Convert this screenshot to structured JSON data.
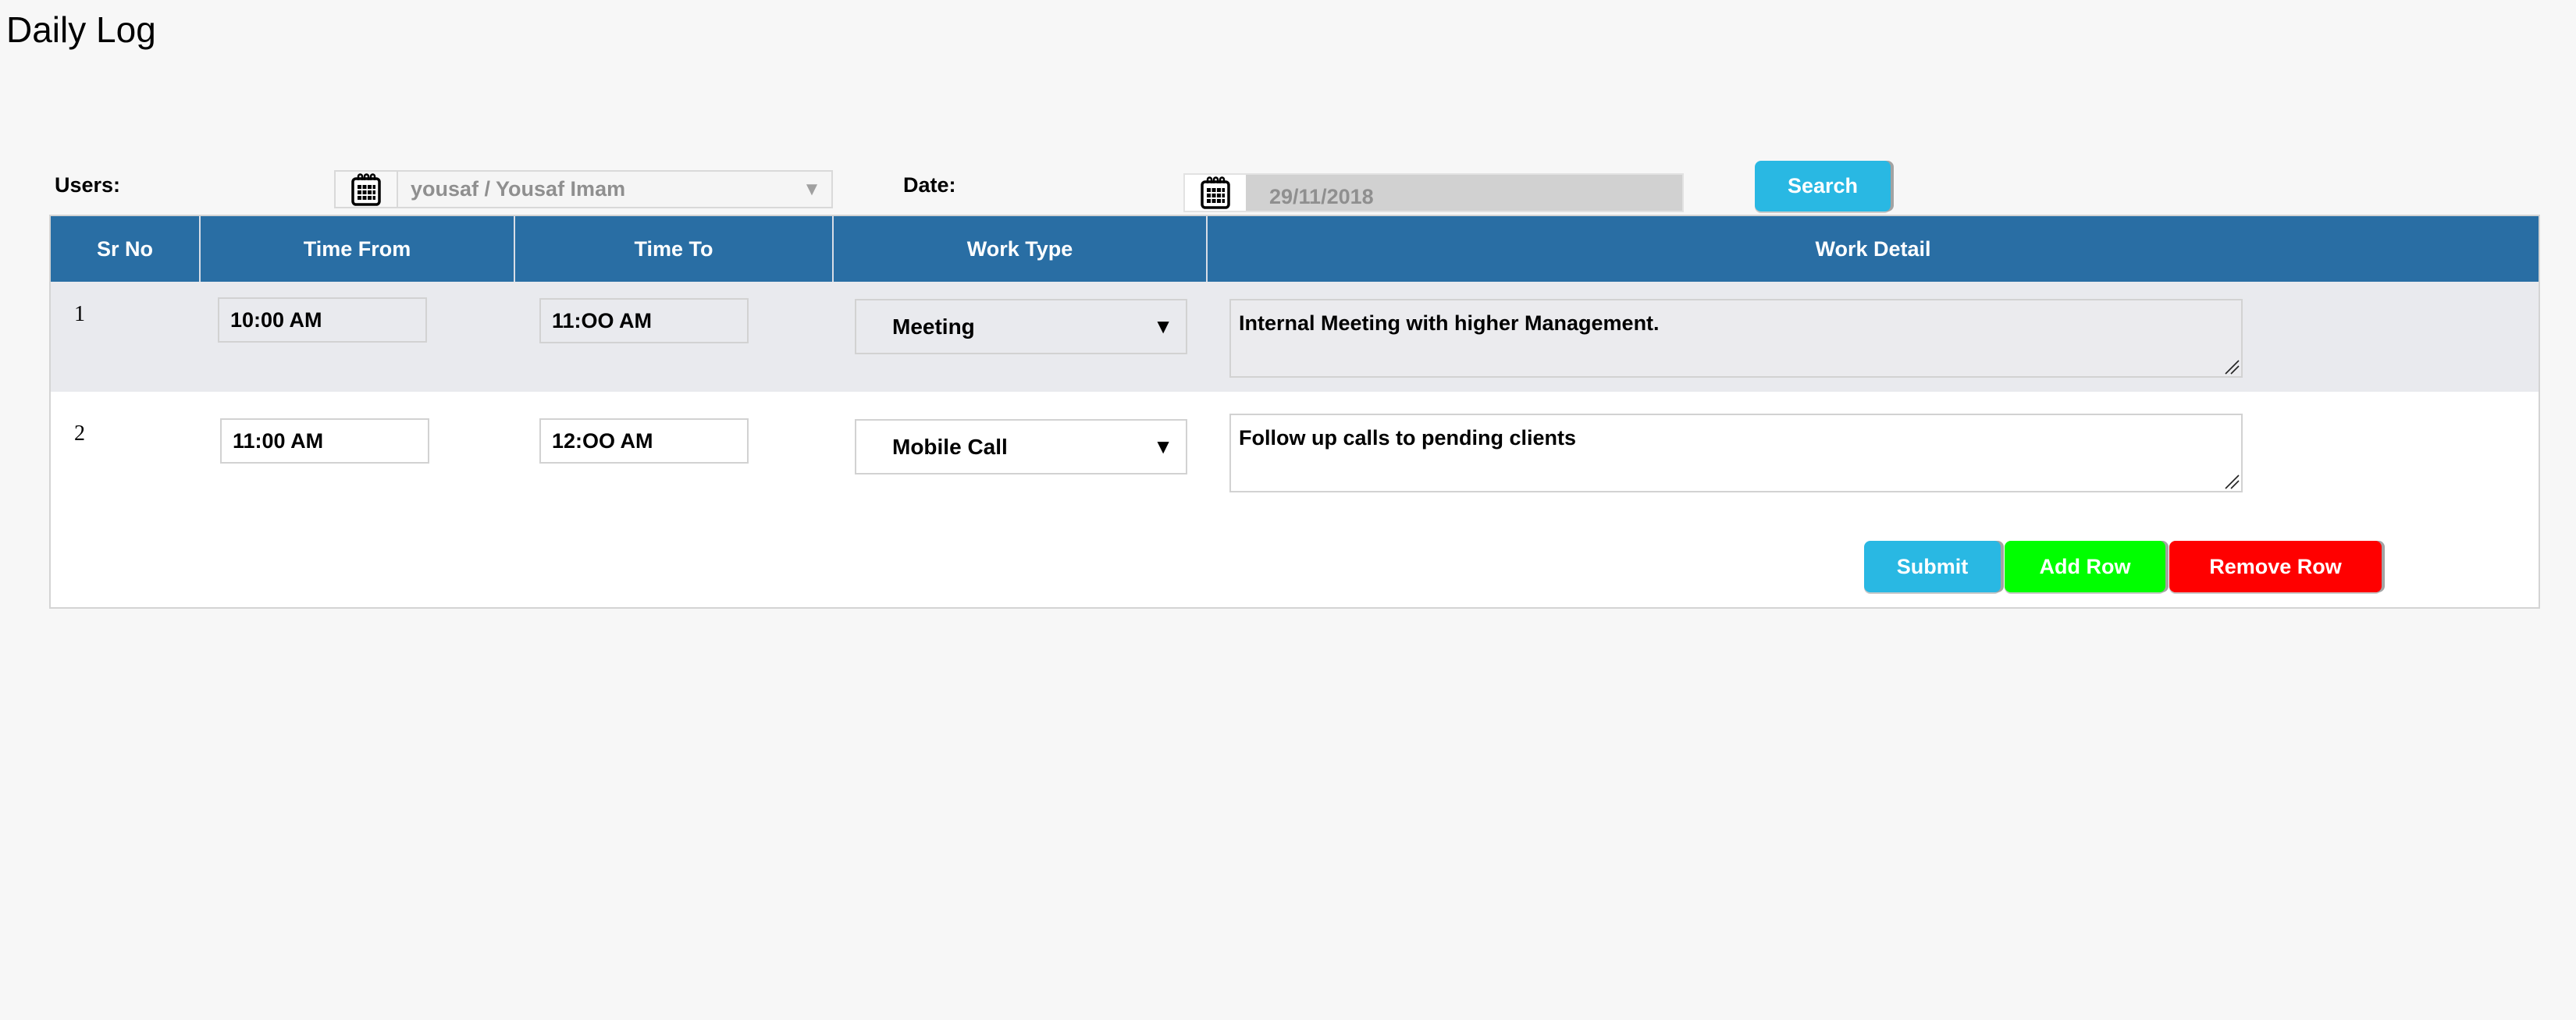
{
  "page": {
    "title": "Daily Log"
  },
  "filters": {
    "users_label": "Users:",
    "users_value": "yousaf / Yousaf Imam",
    "date_label": "Date:",
    "date_value": "29/11/2018",
    "search_label": "Search"
  },
  "table": {
    "columns": [
      "Sr No",
      "Time From",
      "Time To",
      "Work Type",
      "Work Detail"
    ],
    "rows": [
      {
        "sr_no": "1",
        "time_from": "10:00 AM",
        "time_to": "11:OO AM",
        "work_type": "Meeting",
        "work_detail": "Internal Meeting with higher Management."
      },
      {
        "sr_no": "2",
        "time_from": "11:00 AM",
        "time_to": "12:OO AM",
        "work_type": "Mobile Call",
        "work_detail": "Follow up calls to pending clients"
      }
    ]
  },
  "actions": {
    "submit_label": "Submit",
    "add_row_label": "Add Row",
    "remove_row_label": "Remove Row"
  },
  "colors": {
    "header_bg": "#296ea4",
    "alt_row_bg": "#e9eaee",
    "submit": "#29b8e3",
    "add_row": "#00ff00",
    "remove_row": "#ff0000"
  },
  "icons": {
    "calendar": "calendar-icon",
    "dropdown": "caret-down-icon",
    "resize": "resize-grip-icon"
  }
}
